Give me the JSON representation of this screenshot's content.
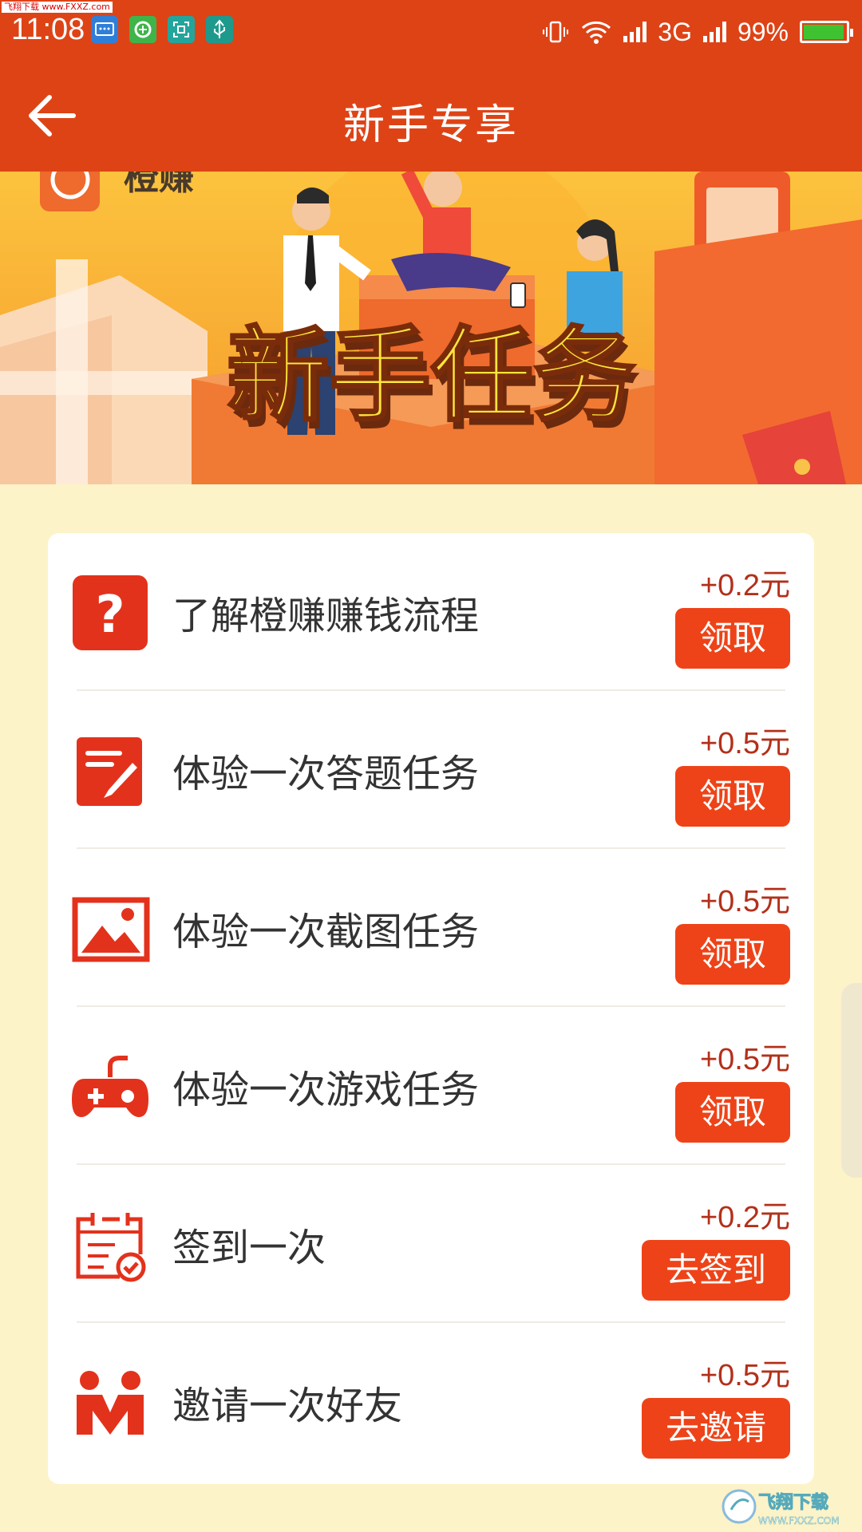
{
  "status_bar": {
    "watermark": "飞翔下载 www.FXXZ.com",
    "time": "11:08",
    "network": "3G",
    "battery": "99%"
  },
  "header": {
    "title": "新手专享"
  },
  "banner": {
    "brand": "橙赚",
    "headline": "新手任务"
  },
  "tasks": [
    {
      "icon": "question-icon",
      "label": "了解橙赚赚钱流程",
      "reward": "+0.2元",
      "action": "领取"
    },
    {
      "icon": "answer-edit-icon",
      "label": "体验一次答题任务",
      "reward": "+0.5元",
      "action": "领取"
    },
    {
      "icon": "image-icon",
      "label": "体验一次截图任务",
      "reward": "+0.5元",
      "action": "领取"
    },
    {
      "icon": "gamepad-icon",
      "label": "体验一次游戏任务",
      "reward": "+0.5元",
      "action": "领取"
    },
    {
      "icon": "calendar-check-icon",
      "label": "签到一次",
      "reward": "+0.2元",
      "action": "去签到"
    },
    {
      "icon": "invite-friends-icon",
      "label": "邀请一次好友",
      "reward": "+0.5元",
      "action": "去邀请"
    }
  ],
  "footer_watermark": {
    "text": "飞翔下载",
    "url": "WWW.FXXZ.COM"
  },
  "colors": {
    "primary": "#de4316",
    "button": "#ee4318",
    "reward": "#b3301a",
    "background": "#fdf3c8"
  }
}
